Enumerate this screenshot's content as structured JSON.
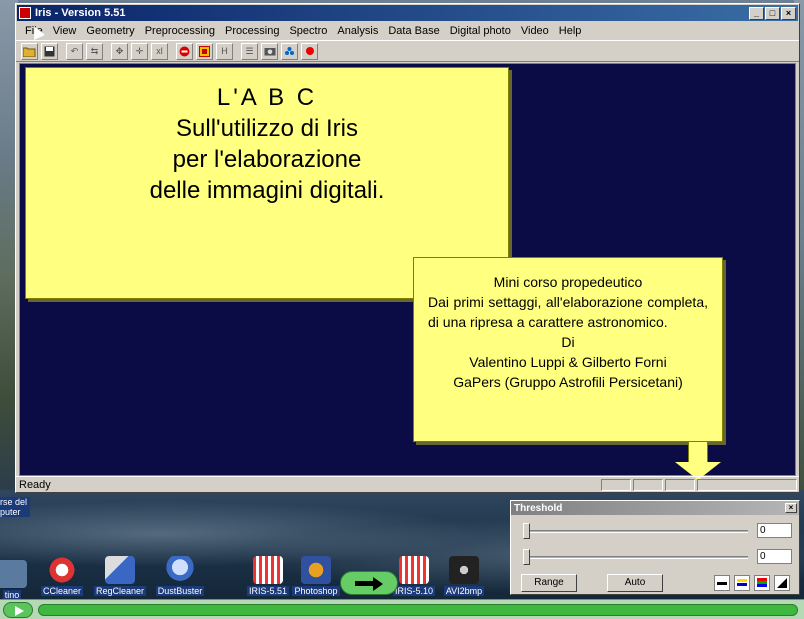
{
  "window": {
    "title": "Iris - Version 5.51",
    "min_label": "_",
    "max_label": "□",
    "close_label": "×"
  },
  "menu": [
    "File",
    "View",
    "Geometry",
    "Preprocessing",
    "Processing",
    "Spectro",
    "Analysis",
    "Data Base",
    "Digital photo",
    "Video",
    "Help"
  ],
  "toolbar": {
    "xl_label": "xl",
    "h_label": "H"
  },
  "slide_main": {
    "line1": "L'A B C",
    "line2": "Sull'utilizzo di Iris",
    "line3": "per l'elaborazione",
    "line4": "delle immagini digitali."
  },
  "slide_note": {
    "line1": "Mini corso propedeutico",
    "line2": "Dai primi settaggi, all'elaborazione completa, di una ripresa a carattere astronomico.",
    "line3": "Di",
    "line4": "Valentino Luppi & Gilberto Forni",
    "line5": "GaPers  (Gruppo Astrofili Persicetani)"
  },
  "status": {
    "text": "Ready"
  },
  "desktop": {
    "left_label": "rse del puter",
    "left_small": "tino",
    "icons": [
      "CCleaner",
      "RegCleaner",
      "DustBuster",
      "IRIS-5.51",
      "Photoshop",
      "IRIS-5.10",
      "AVI2bmp"
    ]
  },
  "threshold": {
    "title": "Threshold",
    "close_label": "×",
    "value1": "0",
    "value2": "0",
    "range_label": "Range",
    "auto_label": "Auto"
  },
  "colors": {
    "slide_bg": "#ffff80",
    "canvas_bg": "#0b0b45",
    "title_bar": "#0a246a"
  }
}
